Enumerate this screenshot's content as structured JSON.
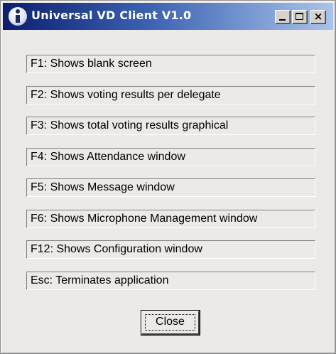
{
  "window": {
    "title": "Universal VD Client V1.0",
    "app_icon": "info-icon",
    "controls": {
      "minimize": "minimize-icon",
      "maximize": "maximize-icon",
      "close_glyph": "×"
    }
  },
  "shortcuts": [
    {
      "label": "F1: Shows blank screen"
    },
    {
      "label": "F2: Shows voting results per delegate"
    },
    {
      "label": "F3: Shows total voting results graphical"
    },
    {
      "label": "F4: Shows Attendance window"
    },
    {
      "label": "F5: Shows Message window"
    },
    {
      "label": "F6: Shows Microphone Management window"
    },
    {
      "label": "F12: Shows Configuration window"
    },
    {
      "label": "Esc: Terminates application"
    }
  ],
  "close_button": {
    "label": "Close"
  },
  "colors": {
    "title_gradient_start": "#0c1e6e",
    "title_gradient_end": "#a9c4ea",
    "dialog_background": "#ece9e6"
  }
}
